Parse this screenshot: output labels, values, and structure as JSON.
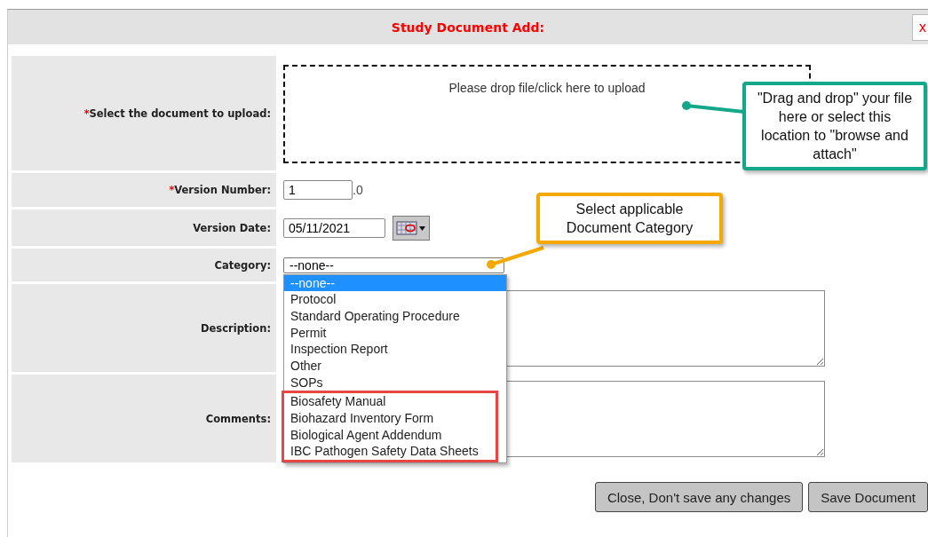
{
  "dialog": {
    "title": "Study Document Add:",
    "close_label": "x"
  },
  "fields": [
    {
      "kind": "upload",
      "label": "Select the document to upload:",
      "required_mark": "*",
      "text": "Please drop file/click here to upload"
    },
    {
      "kind": "number",
      "label": "Version Number:",
      "required_mark": "*",
      "value": "1",
      "suffix": ".0"
    },
    {
      "kind": "date",
      "label": "Version Date:",
      "value": "05/11/2021"
    },
    {
      "kind": "select",
      "label": "Category:",
      "value": "--none--",
      "expanded": true,
      "options": [
        {
          "label": "--none--",
          "selected": true,
          "highlighted": false
        },
        {
          "label": "Protocol",
          "selected": false,
          "highlighted": false
        },
        {
          "label": "Standard Operating Procedure",
          "selected": false,
          "highlighted": false
        },
        {
          "label": "Permit",
          "selected": false,
          "highlighted": false
        },
        {
          "label": "Inspection Report",
          "selected": false,
          "highlighted": false
        },
        {
          "label": "Other",
          "selected": false,
          "highlighted": false
        },
        {
          "label": "SOPs",
          "selected": false,
          "highlighted": false
        },
        {
          "label": "Biosafety Manual",
          "selected": false,
          "highlighted": true
        },
        {
          "label": "Biohazard Inventory Form",
          "selected": false,
          "highlighted": true
        },
        {
          "label": "Biological Agent Addendum",
          "selected": false,
          "highlighted": true
        },
        {
          "label": "IBC Pathogen Safety Data Sheets",
          "selected": false,
          "highlighted": true
        }
      ]
    },
    {
      "kind": "textarea",
      "label": "Description:"
    },
    {
      "kind": "textarea",
      "label": "Comments:"
    }
  ],
  "buttons": [
    "Close, Don't save any changes",
    "Save Document"
  ],
  "callouts": [
    {
      "text": "\"Drag and drop\" your file here or select this location to \"browse and attach\"",
      "color": "#14a88a"
    },
    {
      "text": "Select applicable Document Category",
      "color": "#f5a800"
    }
  ]
}
